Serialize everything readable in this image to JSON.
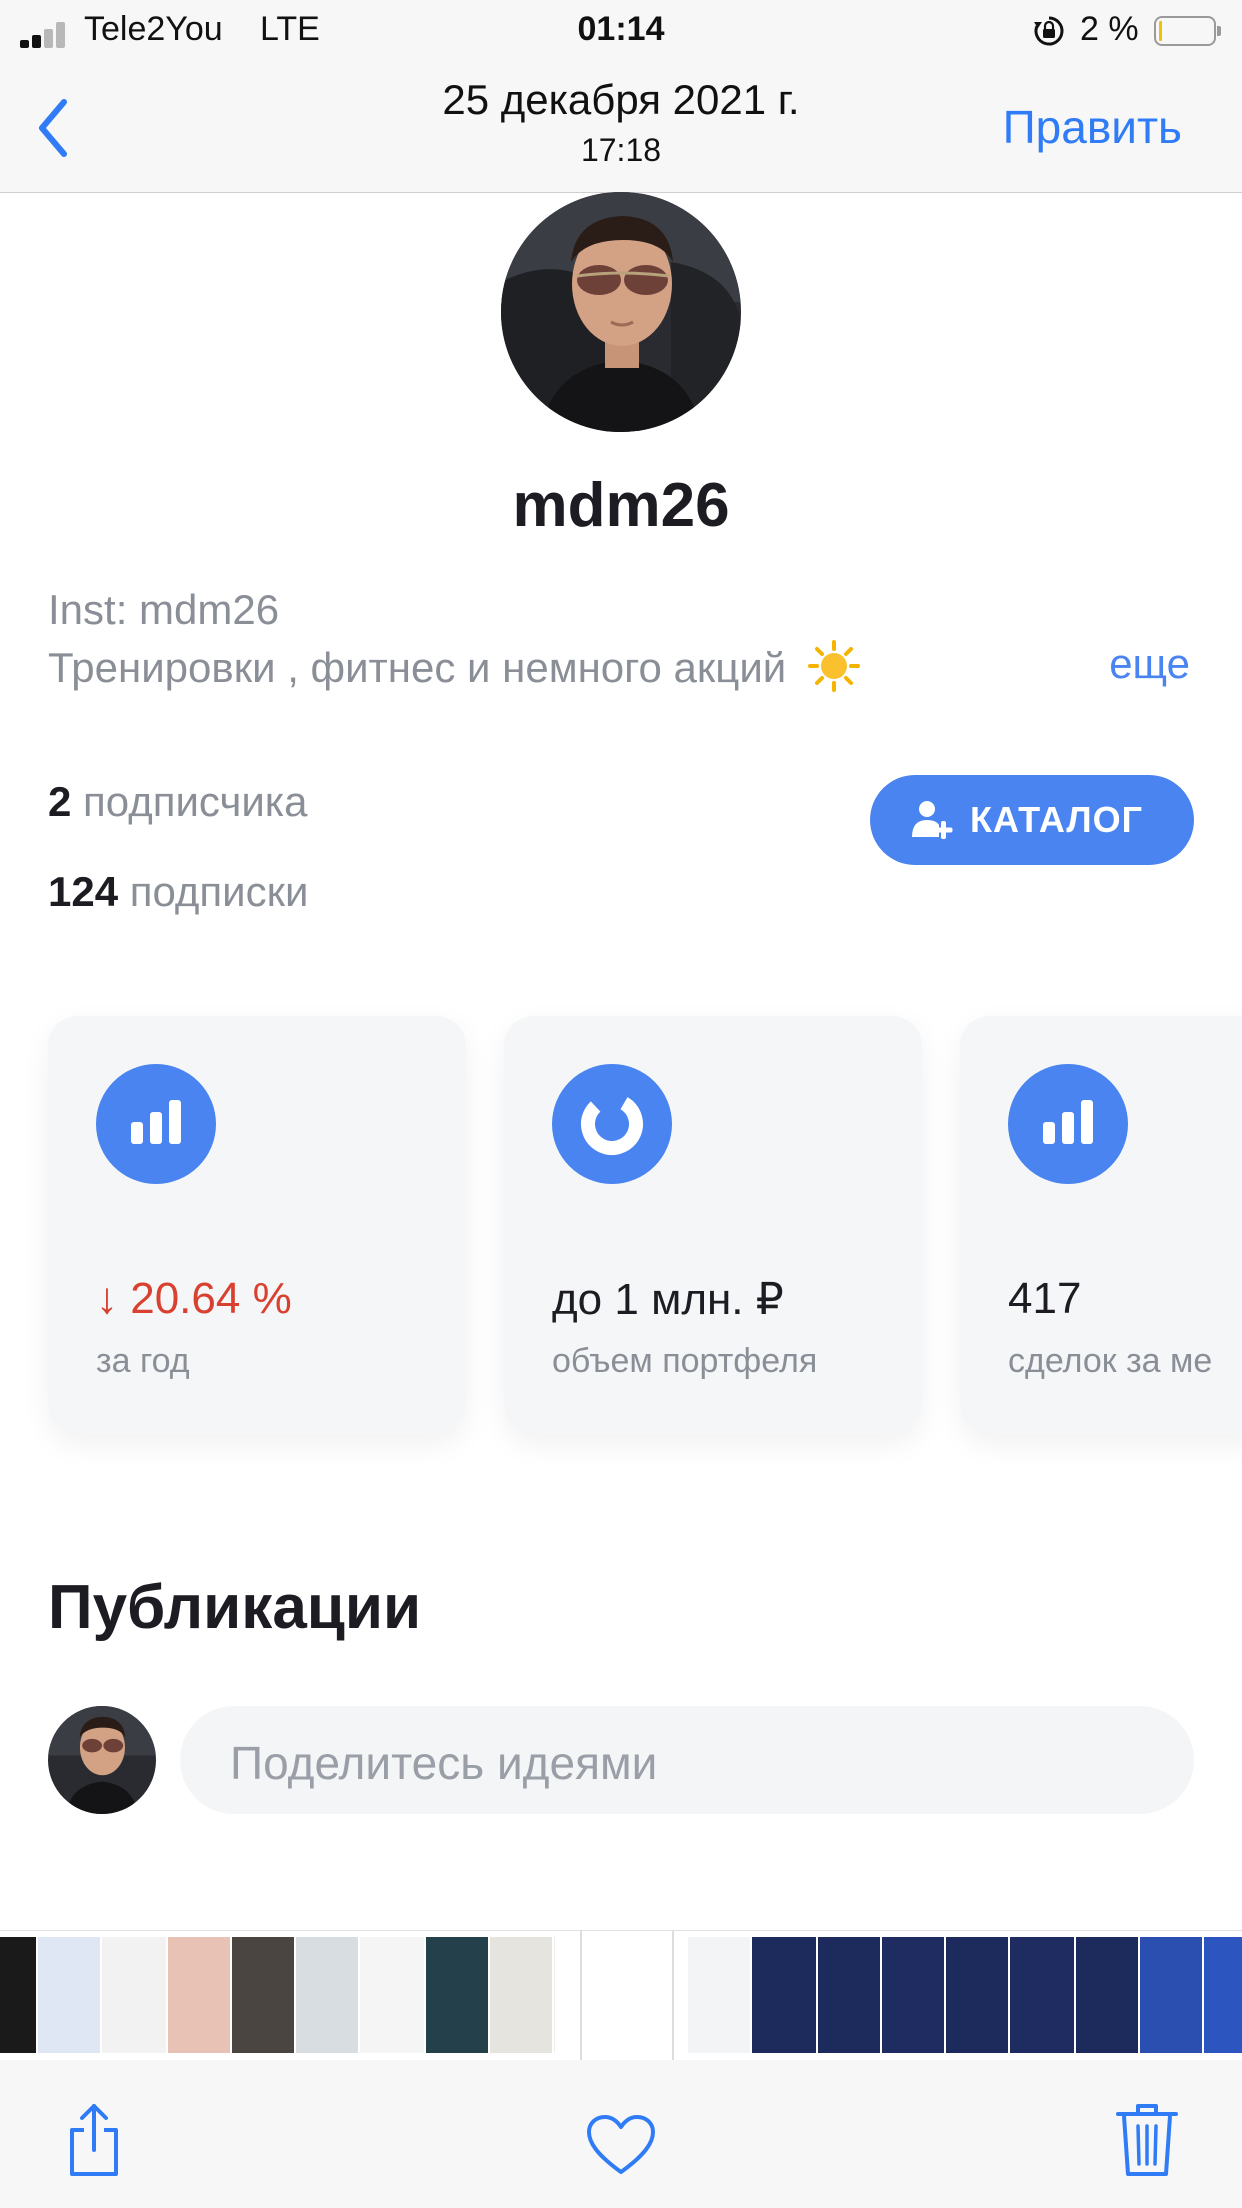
{
  "status_bar": {
    "carrier": "Tele2You",
    "network": "LTE",
    "time": "01:14",
    "battery": "2 %"
  },
  "nav": {
    "date": "25 декабря 2021 г.",
    "time": "17:18",
    "edit": "Править",
    "back_icon": "chevron-left-icon"
  },
  "profile": {
    "username": "mdm26",
    "bio_line1": "Inst: mdm26",
    "bio_line2": "Тренировки , фитнес и немного акций",
    "bio_emoji": "sun-emoji",
    "more": "еще",
    "followers_count": "2",
    "followers_label": "подписчика",
    "following_count": "124",
    "following_label": "подписки",
    "catalog_button": "КАТАЛОГ"
  },
  "stats": [
    {
      "icon": "bar-chart-icon",
      "arrow": "↓",
      "value": "20.64 %",
      "label": "за год",
      "value_color": "#d9402f"
    },
    {
      "icon": "donut-chart-icon",
      "arrow": "",
      "value": "до 1 млн. ₽",
      "label": "объем портфеля",
      "value_color": "#1c1c22"
    },
    {
      "icon": "bar-chart-icon",
      "arrow": "",
      "value": "417",
      "label": "сделок за ме",
      "value_color": "#1c1c22"
    }
  ],
  "publications": {
    "title": "Публикации",
    "placeholder": "Поделитесь идеями"
  },
  "toolbar": {
    "share_icon": "share-icon",
    "favorite_icon": "heart-icon",
    "delete_icon": "trash-icon"
  },
  "colors": {
    "accent": "#4a84f0",
    "ios_blue": "#2f7cf6",
    "negative": "#d9402f"
  }
}
